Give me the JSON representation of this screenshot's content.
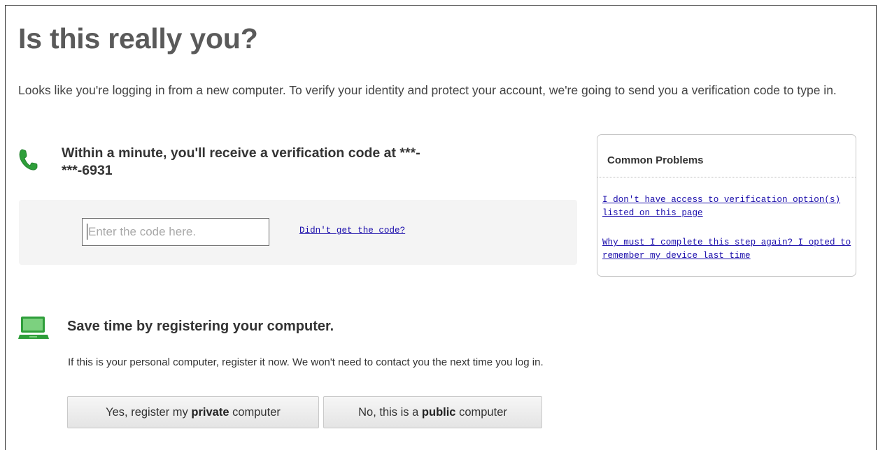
{
  "page": {
    "title": "Is this really you?",
    "intro": "Looks like you're logging in from a new computer. To verify your identity and protect your account, we're going to send you a verification code to type in."
  },
  "phone_section": {
    "heading": "Within a minute, you'll receive a verification code at ***-***-6931",
    "icon": "phone-icon",
    "code_input": {
      "value": "",
      "placeholder": "Enter the code here."
    },
    "didnt_get_link": "Didn't get the code?"
  },
  "common_problems": {
    "title": "Common Problems",
    "links": [
      "I don't have access to verification option(s) listed on this page",
      "Why must I complete this step again? I opted to remember my device last time"
    ]
  },
  "register_section": {
    "icon": "computer-icon",
    "heading": "Save time by registering your computer.",
    "text": "If this is your personal computer, register it now. We won't need to contact you the next time you log in.",
    "private_button": {
      "prefix": "Yes, register my ",
      "bold": "private",
      "suffix": " computer"
    },
    "public_button": {
      "prefix": "No, this is a ",
      "bold": "public",
      "suffix": " computer"
    }
  },
  "colors": {
    "title_gray": "#5a5a5a",
    "icon_green": "#2e9e3a",
    "link_blue": "#1a0dab",
    "panel_bg": "#f4f4f4"
  }
}
